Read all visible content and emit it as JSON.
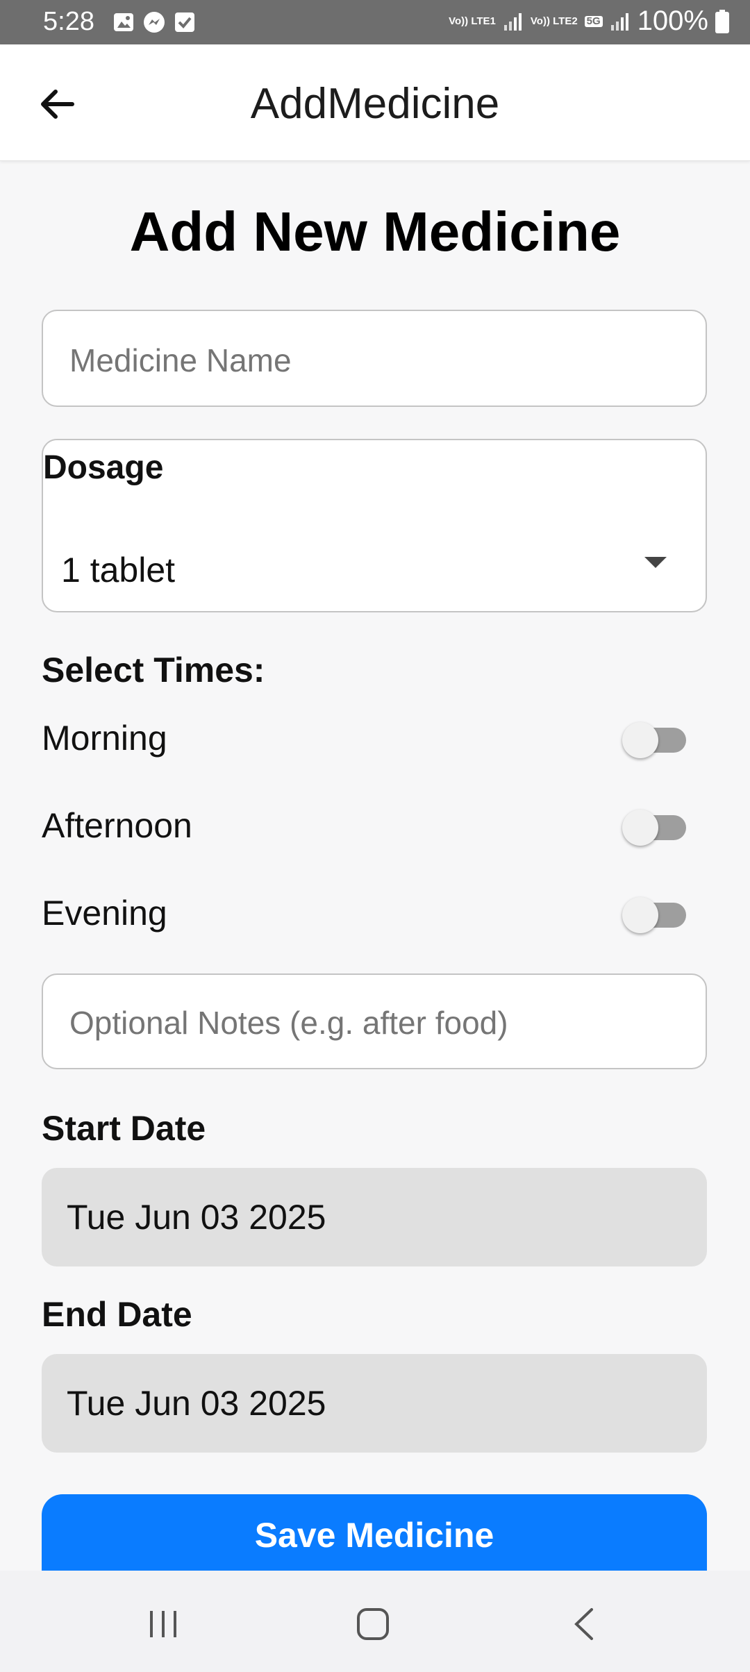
{
  "status_bar": {
    "time": "5:28",
    "network_1": "Vo)) LTE1",
    "network_2": "Vo)) LTE2",
    "network_badge": "5G",
    "battery": "100%",
    "icons": [
      "image-icon",
      "messenger-icon",
      "check-icon",
      "signal-icon",
      "battery-icon"
    ]
  },
  "app_bar": {
    "title": "AddMedicine",
    "back_icon": "arrow-left-icon"
  },
  "form": {
    "heading": "Add New Medicine",
    "medicine_name_placeholder": "Medicine Name",
    "dosage": {
      "label": "Dosage",
      "selected": "1 tablet"
    },
    "times_label": "Select Times:",
    "times": [
      {
        "label": "Morning",
        "enabled": false
      },
      {
        "label": "Afternoon",
        "enabled": false
      },
      {
        "label": "Evening",
        "enabled": false
      }
    ],
    "notes_placeholder": "Optional Notes (e.g. after food)",
    "start_date_label": "Start Date",
    "start_date": "Tue Jun 03 2025",
    "end_date_label": "End Date",
    "end_date": "Tue Jun 03 2025",
    "save_label": "Save Medicine"
  },
  "colors": {
    "primary": "#0a7cff",
    "date_field_bg": "#e0e0e0",
    "page_bg": "#f7f7f8"
  },
  "nav_bar": {
    "icons": [
      "recents-icon",
      "home-icon",
      "back-icon"
    ]
  }
}
